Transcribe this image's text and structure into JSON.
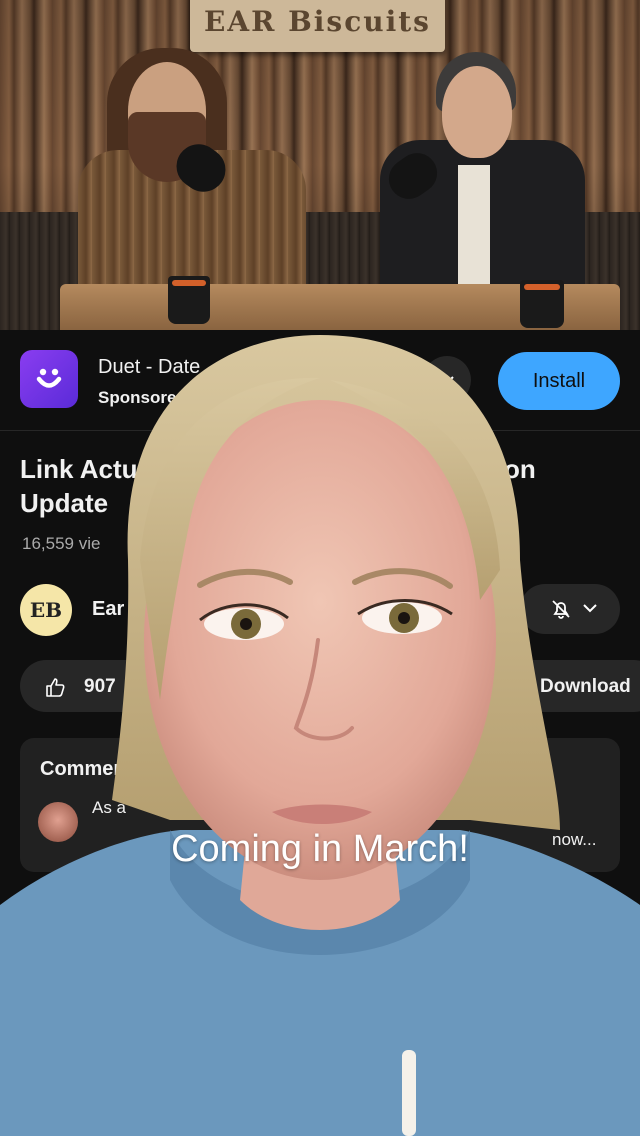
{
  "video": {
    "sign_text": "EAR Biscuits"
  },
  "ad": {
    "title": "Duet - Date",
    "sponsored": "Sponsore",
    "install_label": "Install",
    "colors": {
      "icon": "#7b35ea",
      "install": "#3ea6ff"
    }
  },
  "video_info": {
    "title_line1": "Link Actu",
    "title_line1_right": "on",
    "title_line2": "Update",
    "views": "16,559 vie"
  },
  "channel": {
    "avatar_text": "EB",
    "name": "Ear"
  },
  "actions": {
    "like_count": "907",
    "download_label": "Download"
  },
  "comments": {
    "title": "Comments",
    "first_comment": "As a",
    "more": "now..."
  },
  "overlay": {
    "caption": "Coming in March!"
  }
}
